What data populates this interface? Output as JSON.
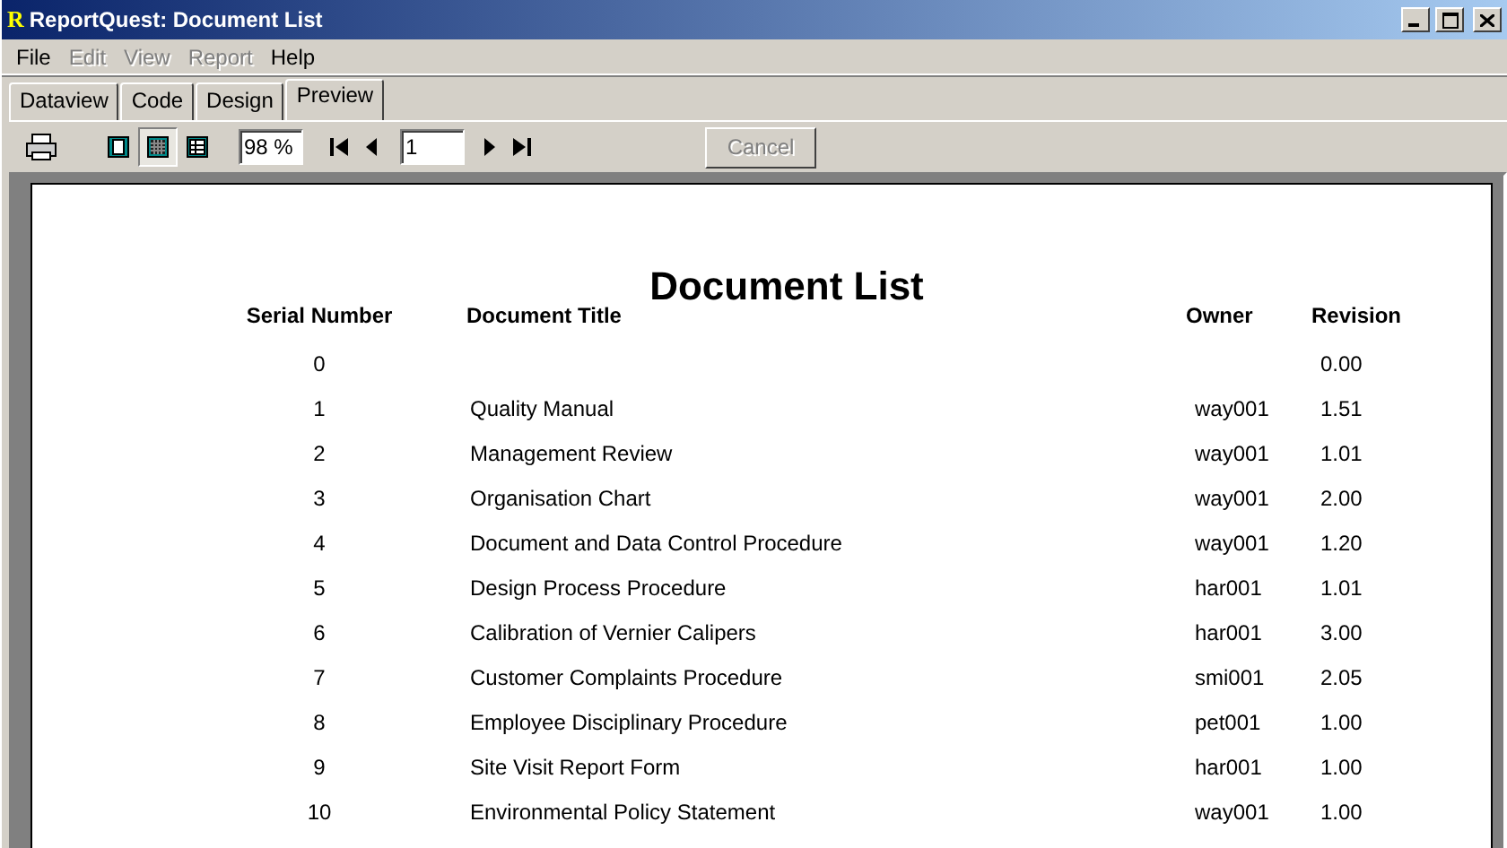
{
  "window": {
    "logo": "R",
    "title": "ReportQuest: Document List"
  },
  "menu": [
    {
      "label": "File",
      "disabled": false
    },
    {
      "label": "Edit",
      "disabled": true
    },
    {
      "label": "View",
      "disabled": true
    },
    {
      "label": "Report",
      "disabled": true
    },
    {
      "label": "Help",
      "disabled": false
    }
  ],
  "tabs": [
    {
      "label": "Dataview",
      "selected": false
    },
    {
      "label": "Code",
      "selected": false
    },
    {
      "label": "Design",
      "selected": false
    },
    {
      "label": "Preview",
      "selected": true
    }
  ],
  "toolbar": {
    "view_modes": [
      {
        "selected": false
      },
      {
        "selected": true
      },
      {
        "selected": false
      }
    ],
    "zoom": "98 %",
    "page": "1",
    "cancel": {
      "label": "Cancel",
      "disabled": true
    }
  },
  "report": {
    "title": "Document List",
    "columns": [
      "Serial Number",
      "Document Title",
      "Owner",
      "Revision"
    ],
    "rows": [
      [
        "0",
        "",
        "",
        "0.00"
      ],
      [
        "1",
        "Quality Manual",
        "way001",
        "1.51"
      ],
      [
        "2",
        "Management Review",
        "way001",
        "1.01"
      ],
      [
        "3",
        "Organisation Chart",
        "way001",
        "2.00"
      ],
      [
        "4",
        "Document and Data Control Procedure",
        "way001",
        "1.20"
      ],
      [
        "5",
        "Design Process Procedure",
        "har001",
        "1.01"
      ],
      [
        "6",
        "Calibration of Vernier Calipers",
        "har001",
        "3.00"
      ],
      [
        "7",
        "Customer Complaints Procedure",
        "smi001",
        "2.05"
      ],
      [
        "8",
        "Employee Disciplinary Procedure",
        "pet001",
        "1.00"
      ],
      [
        "9",
        "Site Visit Report Form",
        "har001",
        "1.00"
      ],
      [
        "10",
        "Environmental Policy Statement",
        "way001",
        "1.00"
      ]
    ]
  }
}
